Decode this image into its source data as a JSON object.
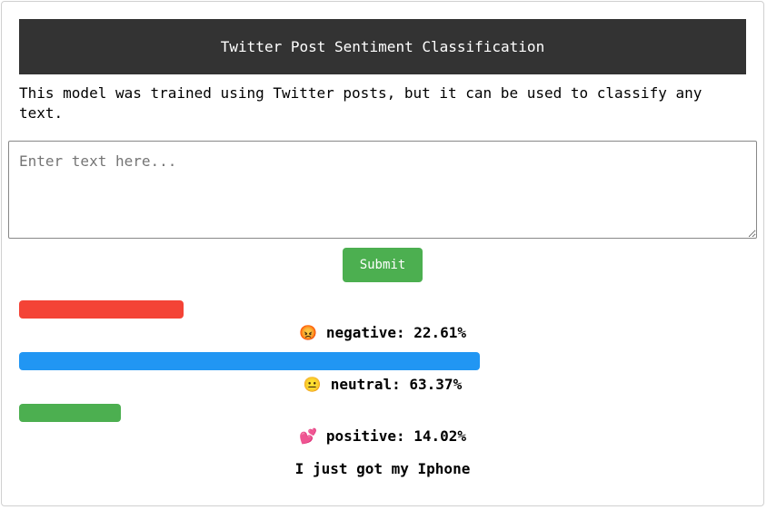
{
  "header": {
    "title": "Twitter Post Sentiment Classification"
  },
  "description": "This model was trained using Twitter posts, but it can be used to classify any text.",
  "input": {
    "placeholder": "Enter text here...",
    "value": ""
  },
  "submit_label": "Submit",
  "results": [
    {
      "label": "negative",
      "value": 22.61,
      "display": "negative: 22.61%",
      "emoji": "😡",
      "color": "#f44336"
    },
    {
      "label": "neutral",
      "value": 63.37,
      "display": "neutral: 63.37%",
      "emoji": "😐",
      "color": "#2196f3"
    },
    {
      "label": "positive",
      "value": 14.02,
      "display": "positive: 14.02%",
      "emoji": "💕",
      "color": "#4caf50"
    }
  ],
  "analyzed_text": "I just got my Iphone"
}
